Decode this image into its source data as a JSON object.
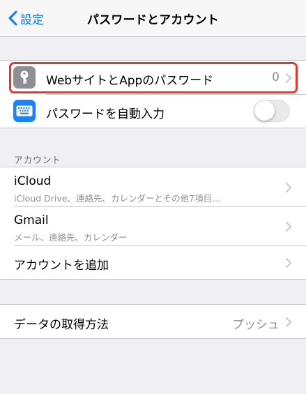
{
  "nav": {
    "back_label": "設定",
    "title": "パスワードとアカウント"
  },
  "passwords_group": {
    "items": [
      {
        "label": "WebサイトとAppのパスワード",
        "value": "0",
        "icon": "key-icon",
        "icon_color": "#8e8e93"
      },
      {
        "label": "パスワードを自動入力",
        "icon": "keyboard-icon",
        "icon_color": "#1a82fb",
        "toggle_on": false
      }
    ]
  },
  "accounts_group": {
    "header": "アカウント",
    "items": [
      {
        "label": "iCloud",
        "detail": "iCloud Drive、連絡先、カレンダーとその他7項目..."
      },
      {
        "label": "Gmail",
        "detail": "メール、連絡先、カレンダー"
      },
      {
        "label": "アカウントを追加"
      }
    ]
  },
  "fetch_group": {
    "items": [
      {
        "label": "データの取得方法",
        "value": "プッシュ"
      }
    ]
  },
  "colors": {
    "accent": "#007aff",
    "highlight": "#e8362b"
  }
}
